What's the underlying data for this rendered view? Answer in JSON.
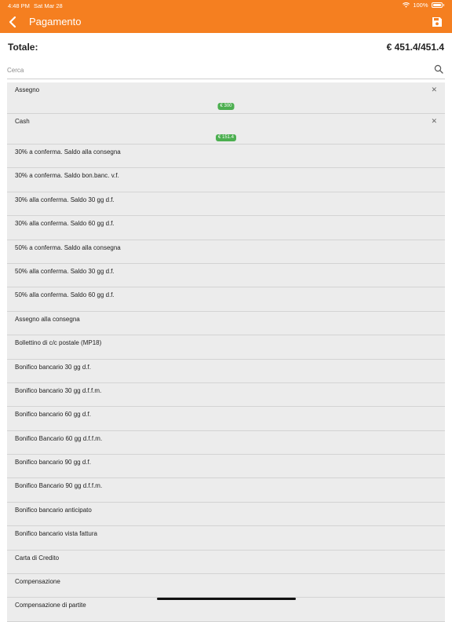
{
  "status": {
    "time": "4:48 PM",
    "date": "Sat Mar 28",
    "battery": "100%"
  },
  "nav": {
    "title": "Pagamento",
    "back_icon": "chevron-left-icon",
    "save_icon": "save-icon"
  },
  "totals": {
    "label": "Totale:",
    "value": "€ 451.4/451.4"
  },
  "search": {
    "placeholder": "Cerca",
    "value": ""
  },
  "selected": [
    {
      "label": "Assegno",
      "amount": "€ 300"
    },
    {
      "label": "Cash",
      "amount": "€ 151.4"
    }
  ],
  "items": [
    "30% a conferma. Saldo alla consegna",
    "30% a conferma. Saldo bon.banc. v.f.",
    "30% alla conferma. Saldo 30 gg d.f.",
    "30% alla conferma. Saldo 60 gg d.f.",
    "50% a conferma. Saldo alla consegna",
    "50% alla conferma. Saldo 30 gg d.f.",
    "50% alla conferma. Saldo 60 gg d.f.",
    "Assegno alla consegna",
    "Bollettino di c/c postale (MP18)",
    "Bonifico bancario 30 gg d.f.",
    "Bonifico bancario 30 gg d.f.f.m.",
    "Bonifico bancario 60 gg d.f.",
    "Bonifico Bancario 60 gg d.f.f.m.",
    "Bonifico bancario 90 gg d.f.",
    "Bonifico Bancario 90 gg d.f.f.m.",
    "Bonifico bancario anticipato",
    "Bonifico bancario vista fattura",
    "Carta di Credito",
    "Compensazione",
    "Compensazione di partite"
  ],
  "colors": {
    "accent": "#f57f20",
    "badge": "#4caf50",
    "row_bg": "#ececec"
  }
}
